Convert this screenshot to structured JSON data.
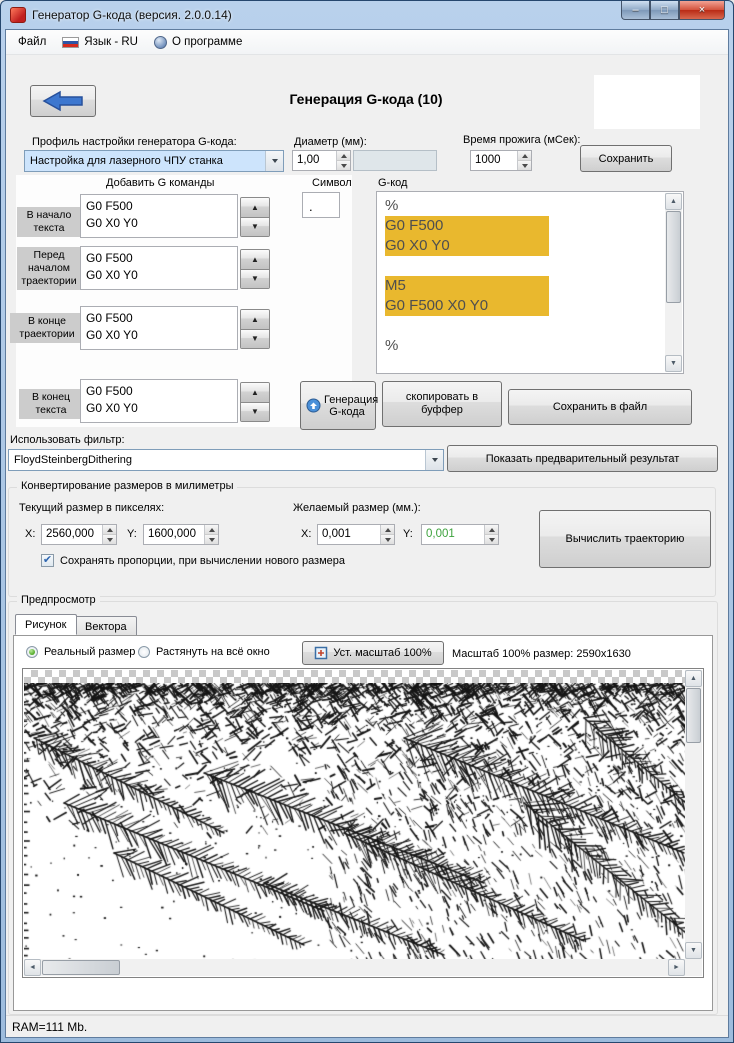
{
  "window": {
    "title": "Генератор G-кода (версия. 2.0.0.14)",
    "status_bar": "RAM=111 Mb."
  },
  "menu": {
    "file": "Файл",
    "language": "Язык - RU",
    "about": "О программе"
  },
  "header": {
    "title": "Генерация G-кода (10)"
  },
  "profile": {
    "label": "Профиль настройки генератора G-кода:",
    "value": "Настройка для лазерного ЧПУ станка"
  },
  "diameter": {
    "label": "Диаметр (мм):",
    "value": "1,00"
  },
  "burn_time": {
    "label": "Время прожига (мСек):",
    "value": "1000"
  },
  "save_button": "Сохранить",
  "gcommands": {
    "header": "Добавить G команды",
    "symbol_header": "Символ",
    "symbol_value": ".",
    "gcode_header": "G-код",
    "rows": [
      {
        "label": "В начало текста",
        "value": "G0 F500\nG0 X0 Y0"
      },
      {
        "label": "Перед началом траектории",
        "value": "G0 F500\nG0 X0 Y0"
      },
      {
        "label": "В конце траектории",
        "value": "G0 F500\nG0 X0 Y0"
      },
      {
        "label": "В конец текста",
        "value": "G0 F500\nG0 X0 Y0"
      }
    ]
  },
  "gcode_output": {
    "lines": [
      {
        "text": "%",
        "highlight": false
      },
      {
        "text": "G0 F500",
        "highlight": true
      },
      {
        "text": "G0 X0 Y0",
        "highlight": true
      },
      {
        "text": "",
        "highlight": false
      },
      {
        "text": "M5",
        "highlight": true
      },
      {
        "text": "G0 F500 X0 Y0",
        "highlight": true
      },
      {
        "text": "",
        "highlight": false
      },
      {
        "text": "%",
        "highlight": false
      }
    ]
  },
  "actions": {
    "generate": "Генерация G-кода",
    "copy": "скопировать в буффер",
    "save_file": "Сохранить в файл"
  },
  "filter": {
    "label": "Использовать фильтр:",
    "value": "FloydSteinbergDithering",
    "preview_button": "Показать предварительный результат"
  },
  "convert": {
    "group_title": "Конвертирование размеров в милиметры",
    "current_label": "Текущий размер в пикселях:",
    "desired_label": "Желаемый размер (мм.):",
    "x_label": "X:",
    "y_label": "Y:",
    "current_x": "2560,000",
    "current_y": "1600,000",
    "desired_x": "0,001",
    "desired_y": "0,001",
    "calc_button": "Вычислить траекторию",
    "keep_proportions": "Сохранять пропорции, при вычислении нового размера"
  },
  "preview": {
    "group_title": "Предпросмотр",
    "tabs": [
      {
        "label": "Рисунок"
      },
      {
        "label": "Вектора"
      }
    ],
    "radio_real": "Реальный размер",
    "radio_stretch": "Растянуть на всё окно",
    "scale_button": "Уст. масштаб 100%",
    "scale_info": "Масштаб 100% размер: 2590x1630"
  },
  "icons": {
    "minimize": "–",
    "maximize": "□",
    "close": "×",
    "scroll_up": "▲",
    "scroll_down": "▼",
    "scroll_left": "◄",
    "scroll_right": "►",
    "spinner_up": "▲",
    "spinner_down": "▼",
    "check": "✔"
  }
}
